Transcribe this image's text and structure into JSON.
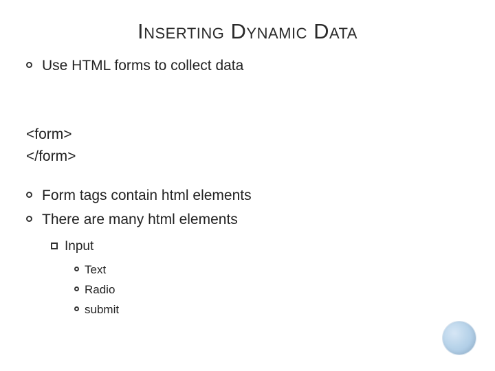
{
  "title": "Inserting Dynamic Data",
  "bullets": {
    "b1": "Use HTML forms to collect data",
    "code1": "<form>",
    "code2": "</form>",
    "b2": "Form tags contain html elements",
    "b3": "There are many html elements",
    "s1": "Input",
    "t1": "Text",
    "t2": "Radio",
    "t3": "submit"
  }
}
